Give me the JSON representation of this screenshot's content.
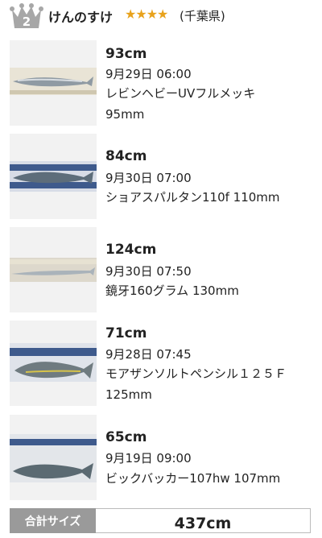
{
  "header": {
    "rank": "2",
    "user_name": "けんのすけ",
    "stars": "★★★★",
    "prefecture": "(千葉県)"
  },
  "catches": [
    {
      "size": "93cm",
      "datetime": "9月29日 06:00",
      "lure": "レビンヘビーUVフルメッキ　95mm"
    },
    {
      "size": "84cm",
      "datetime": "9月30日 07:00",
      "lure": "ショアスパルタン110f 110mm"
    },
    {
      "size": "124cm",
      "datetime": "9月30日 07:50",
      "lure": "鏡牙160グラム 130mm"
    },
    {
      "size": "71cm",
      "datetime": "9月28日 07:45",
      "lure": "モアザンソルトペンシル１２５Ｆ 125mm"
    },
    {
      "size": "65cm",
      "datetime": "9月19日 09:00",
      "lure": "ビックバッカー107hw 107mm"
    }
  ],
  "total": {
    "label": "合計サイズ",
    "value": "437cm"
  },
  "colors": {
    "star": "#e8a21c",
    "crown_silver": "#a7a7a7",
    "total_label_bg": "#9a9a9a"
  }
}
